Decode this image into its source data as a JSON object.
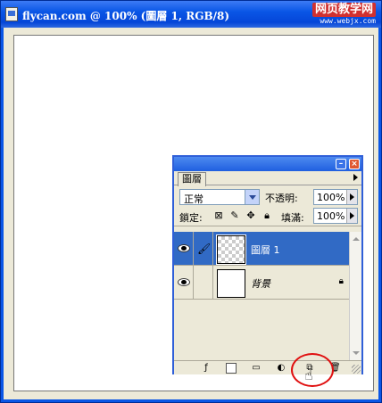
{
  "document": {
    "title": "flycan.com @ 100% (圖層 1, RGB/8)",
    "watermark_main": "网页教学网",
    "watermark_sub": "www.webjx.com"
  },
  "palette": {
    "tab_label": "圖層",
    "blend_mode": "正常",
    "opacity_label": "不透明:",
    "opacity_value": "100%",
    "lock_label": "鎖定:",
    "fill_label": "填滿:",
    "fill_value": "100%",
    "layers": [
      {
        "name": "圖層 1",
        "selected": true,
        "thumbnail": "transparent"
      },
      {
        "name": "背景",
        "selected": false,
        "thumbnail": "white",
        "locked": true
      }
    ],
    "bottom_icons": [
      "layer-style-icon",
      "layer-mask-icon",
      "new-group-icon",
      "adjustment-layer-icon",
      "new-layer-icon",
      "trash-icon"
    ]
  },
  "colors": {
    "titlebar": "#0a56e6",
    "selection": "#316ac5",
    "highlight": "#e01010"
  }
}
